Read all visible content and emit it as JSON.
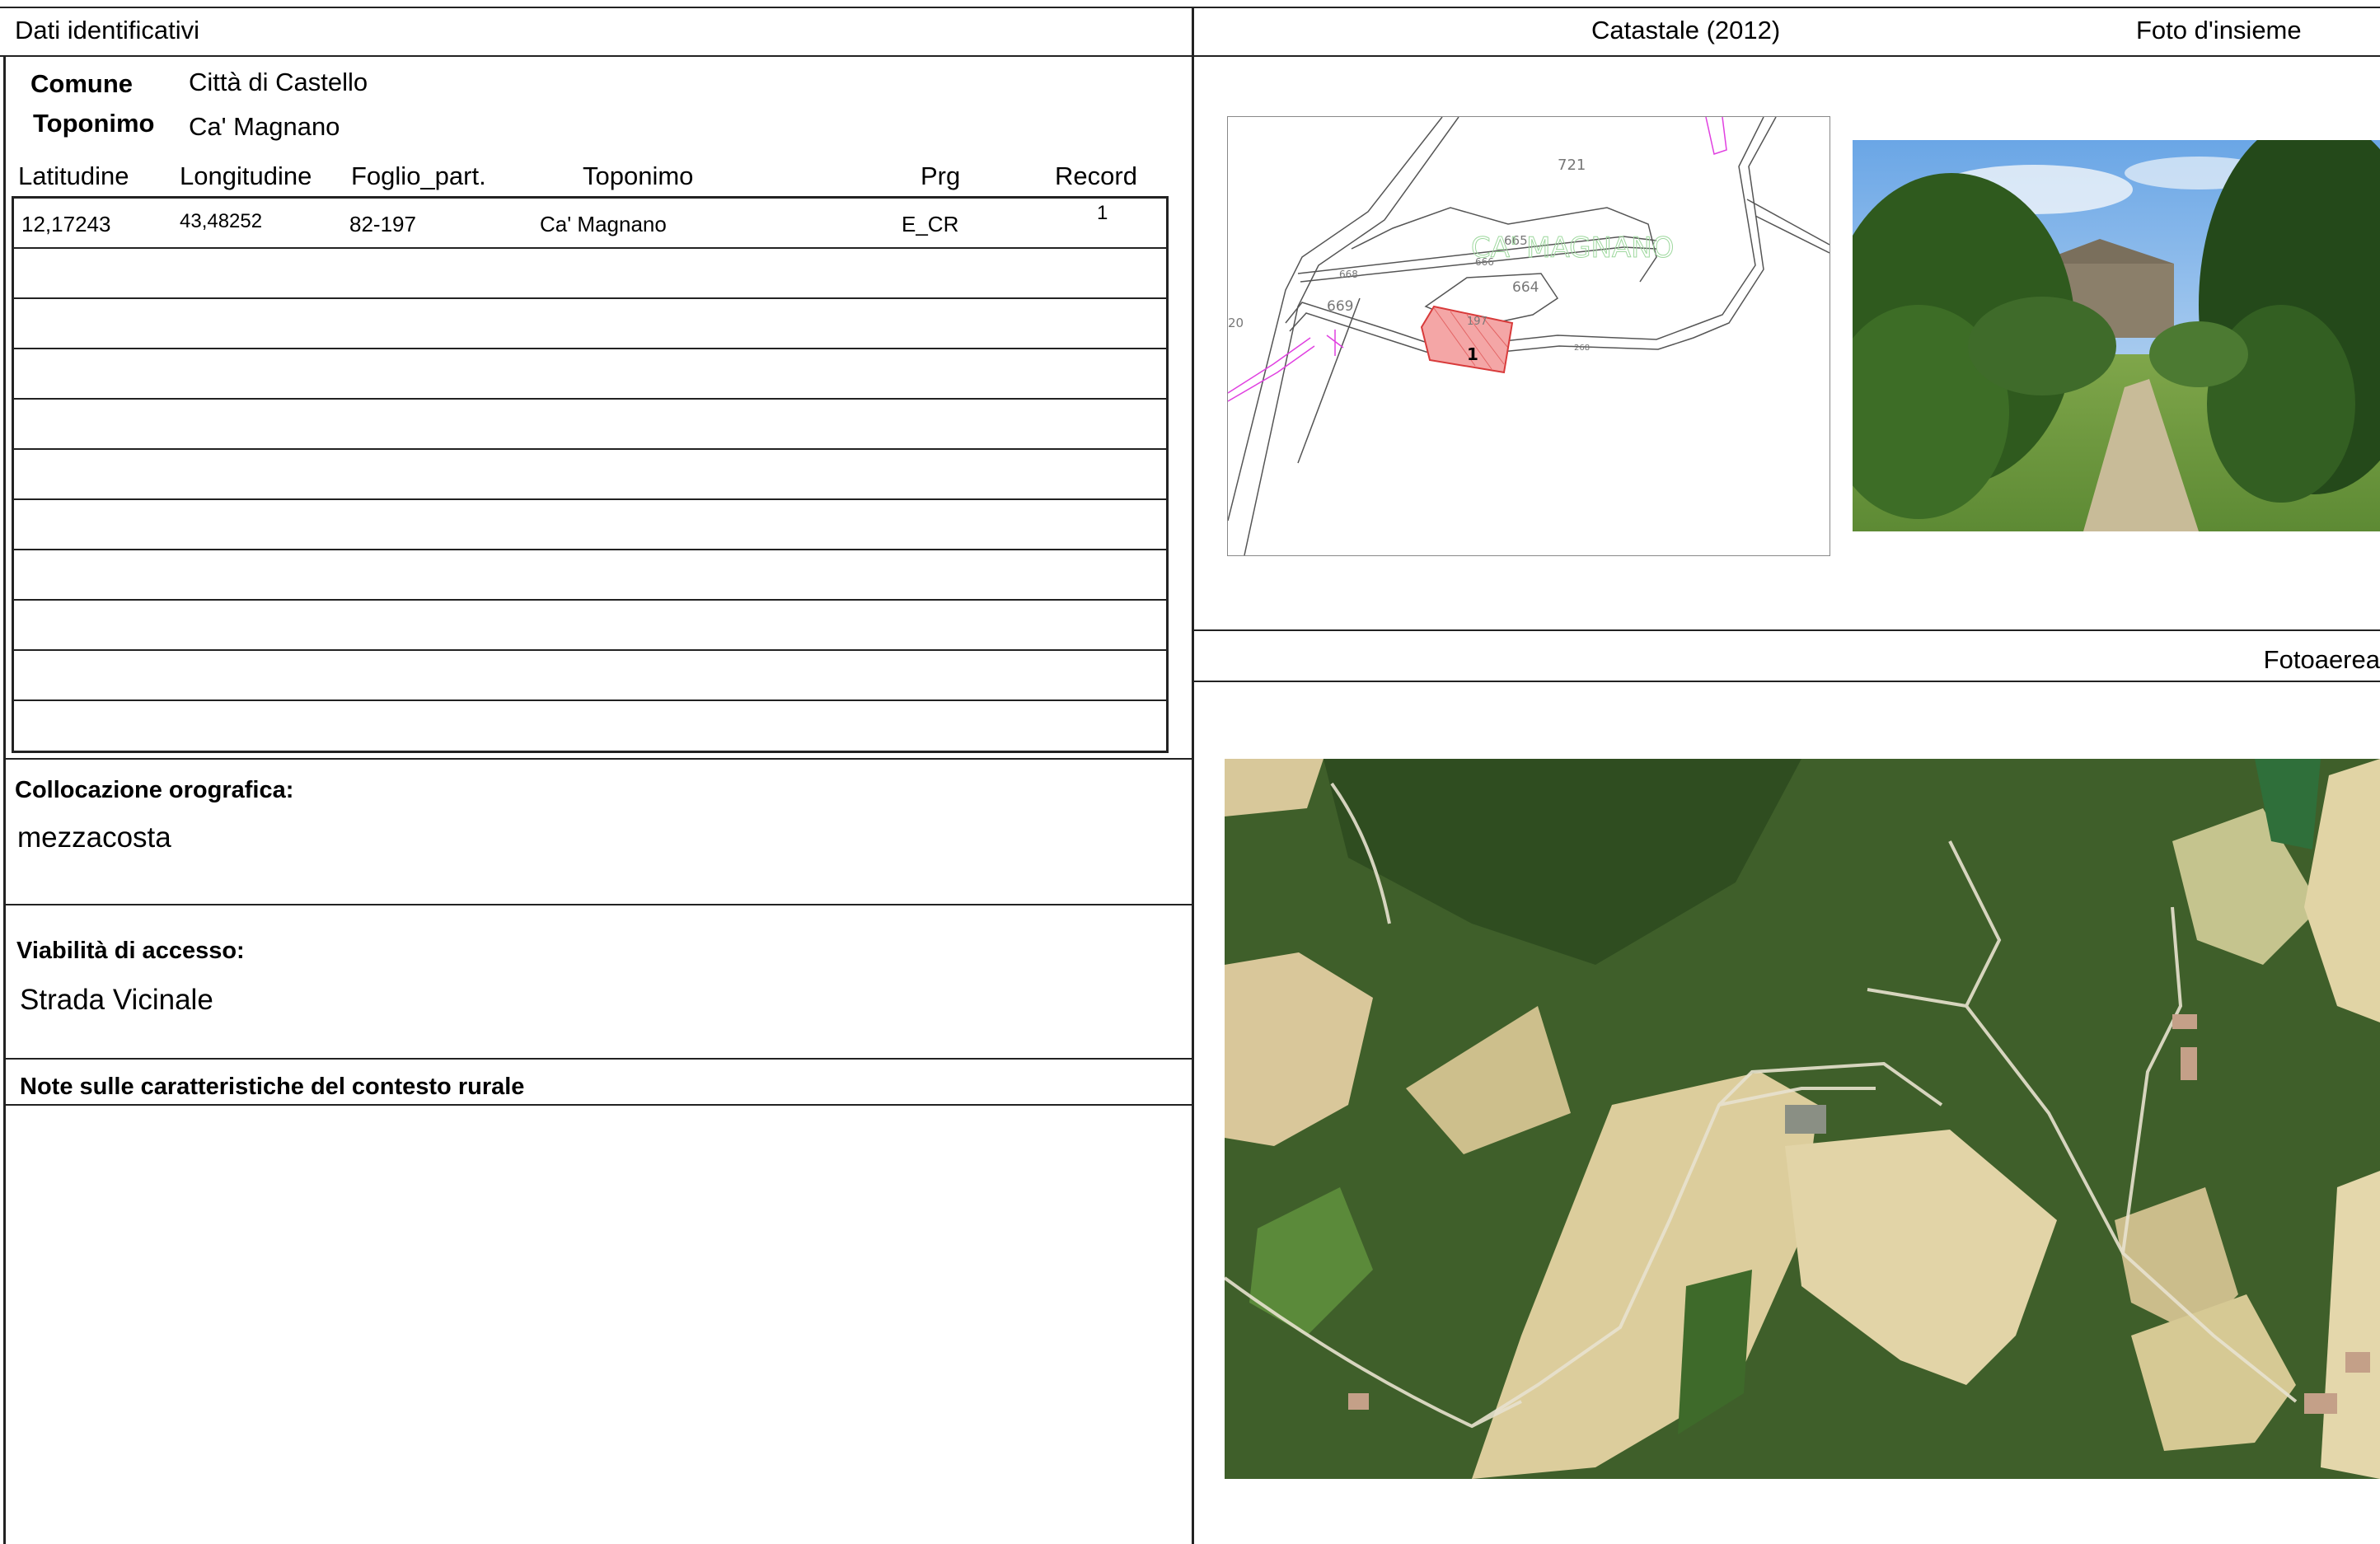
{
  "sections": {
    "identification": "Dati identificativi",
    "cadastral": "Catastale (2012)",
    "overall_photo": "Foto d'insieme",
    "aerial_photo": "Fotoaerea"
  },
  "identity": {
    "comune_label": "Comune",
    "comune_value": "Città di Castello",
    "toponimo_label": "Toponimo",
    "toponimo_value": "Ca' Magnano"
  },
  "table": {
    "columns": [
      "Latitudine",
      "Longitudine",
      "Foglio_part.",
      "Toponimo",
      "Prg",
      "Record"
    ],
    "rows": [
      [
        "12,17243",
        "43,48252",
        "82-197",
        "Ca' Magnano",
        "E_CR",
        "1"
      ]
    ]
  },
  "orography": {
    "label": "Collocazione orografica:",
    "value": "mezzacosta"
  },
  "access": {
    "label": "Viabilità di accesso:",
    "value": "Strada Vicinale"
  },
  "notes": {
    "label": "Note sulle caratteristiche del contesto rurale"
  },
  "map_labels": {
    "parcel_721": "721",
    "parcel_665": "665",
    "parcel_666": "666",
    "parcel_668": "668",
    "parcel_664": "664",
    "parcel_669": "669",
    "parcel_197": "197",
    "parcel_268": "268",
    "parcel_20": "20",
    "record_marker": "1",
    "place_name": "CA' MAGNANO"
  },
  "colors": {
    "parcel_fill": "#f4a6a6",
    "parcel_stroke": "#d83a3a",
    "boundary_line": "#e040e0",
    "place_label": "#9ed89e"
  }
}
